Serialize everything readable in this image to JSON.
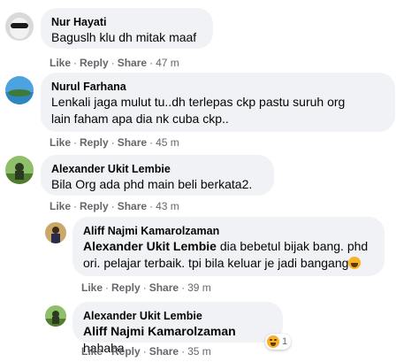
{
  "comments": [
    {
      "author": "Nur Hayati",
      "text": "Baguslh klu dh mitak maaf",
      "actions": {
        "like": "Like",
        "reply": "Reply",
        "share": "Share",
        "time": "47 m"
      }
    },
    {
      "author": "Nurul Farhana",
      "text_line1": "Lenkali jaga mulut tu..dh terlepas ckp pastu suruh org",
      "text_line2": "lain faham apa dia nk cuba ckp..",
      "actions": {
        "like": "Like",
        "reply": "Reply",
        "share": "Share",
        "time": "45 m"
      }
    },
    {
      "author": "Alexander Ukit Lembie",
      "text": "Bila Org ada phd main beli berkata2.",
      "actions": {
        "like": "Like",
        "reply": "Reply",
        "share": "Share",
        "time": "43 m"
      }
    },
    {
      "author": "Aliff Najmi Kamarolzaman",
      "mention": "Alexander Ukit Lembie",
      "text_line1": " dia bebetul bijak bang. phd",
      "text_line2": "ori. pelajar terbaik. tpi bila keluar je jadi bangang",
      "actions": {
        "like": "Like",
        "reply": "Reply",
        "share": "Share",
        "time": "39 m"
      }
    },
    {
      "author": "Alexander Ukit Lembie",
      "mention": "Aliff Najmi Kamarolzaman",
      "text": " hahaha",
      "reaction_count": "1",
      "reaction_icon": "haha-emoji-icon",
      "actions": {
        "like": "Like",
        "reply": "Reply",
        "share": "Share",
        "time": "35 m"
      }
    }
  ],
  "separator": "·",
  "colors": {
    "bubble": "#f0f2f5",
    "meta": "#65676b",
    "emoji": "#f7b125"
  }
}
